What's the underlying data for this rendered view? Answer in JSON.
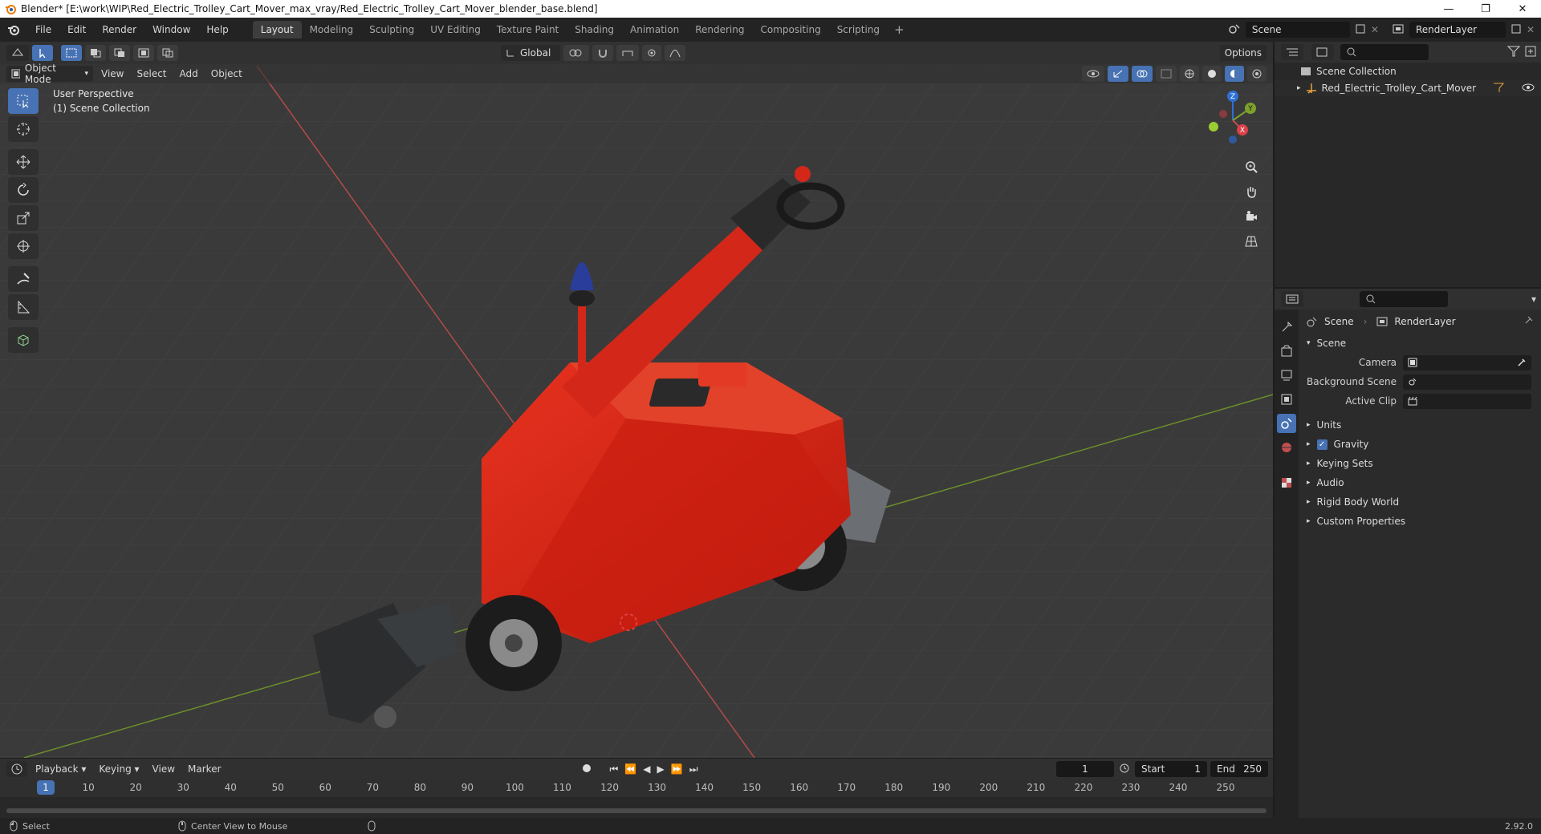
{
  "titlebar": {
    "title": "Blender* [E:\\work\\WIP\\Red_Electric_Trolley_Cart_Mover_max_vray/Red_Electric_Trolley_Cart_Mover_blender_base.blend]",
    "minimize": "—",
    "maximize": "❐",
    "close": "✕"
  },
  "menubar": {
    "items": [
      "File",
      "Edit",
      "Render",
      "Window",
      "Help"
    ],
    "workspaces": [
      "Layout",
      "Modeling",
      "Sculpting",
      "UV Editing",
      "Texture Paint",
      "Shading",
      "Animation",
      "Rendering",
      "Compositing",
      "Scripting"
    ],
    "active_workspace": "Layout",
    "add": "+",
    "scene": "Scene",
    "view_layer": "RenderLayer"
  },
  "viewport": {
    "mode": "Object Mode",
    "menus": [
      "View",
      "Select",
      "Add",
      "Object"
    ],
    "transform_orientation": "Global",
    "options": "Options",
    "overlay_line1": "User Perspective",
    "overlay_line2": "(1) Scene Collection",
    "gizmo_axes": {
      "x": "X",
      "y": "Y",
      "z": "Z"
    },
    "colors": {
      "background": "#3a3a3a",
      "x_axis": "#c24f4f",
      "y_axis": "#7ea12c",
      "cart_red": "#d42414",
      "accent": "#4772b3"
    }
  },
  "outliner": {
    "root": "Scene Collection",
    "items": [
      {
        "name": "Red_Electric_Trolley_Cart_Mover",
        "icon": "empty-icon"
      }
    ]
  },
  "properties": {
    "breadcrumb_scene": "Scene",
    "breadcrumb_layer": "RenderLayer",
    "panel": "Scene",
    "fields": [
      {
        "label": "Camera",
        "value": ""
      },
      {
        "label": "Background Scene",
        "value": ""
      },
      {
        "label": "Active Clip",
        "value": ""
      }
    ],
    "subpanels": [
      "Units",
      "Gravity",
      "Keying Sets",
      "Audio",
      "Rigid Body World",
      "Custom Properties"
    ],
    "gravity_enabled": true
  },
  "timeline": {
    "menus": [
      "Playback",
      "Keying",
      "View",
      "Marker"
    ],
    "current_frame": "1",
    "start_label": "Start",
    "start": "1",
    "end_label": "End",
    "end": "250",
    "ruler": [
      "1",
      "10",
      "20",
      "30",
      "40",
      "50",
      "60",
      "70",
      "80",
      "90",
      "100",
      "110",
      "120",
      "130",
      "140",
      "150",
      "160",
      "170",
      "180",
      "190",
      "200",
      "210",
      "220",
      "230",
      "240",
      "250"
    ]
  },
  "statusbar": {
    "left_action": "Select",
    "middle_action": "Center View to Mouse",
    "version": "2.92.0"
  }
}
